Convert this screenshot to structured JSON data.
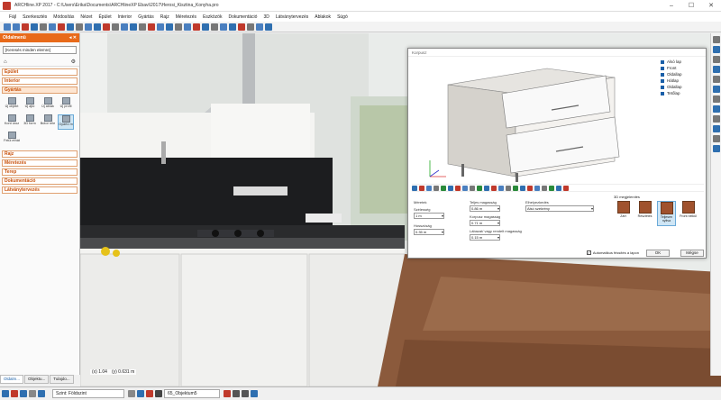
{
  "window": {
    "title": "ARCHline.XP 2017 - C:\\Users\\Erika\\Documents\\ARCHlineXP Ebavi\\2017\\Herosi_Kisztina_Konyha.pro",
    "minimize": "–",
    "maximize": "☐",
    "close": "✕"
  },
  "menu": [
    "Fájl",
    "Szerkesztés",
    "Módosítás",
    "Nézet",
    "Épület",
    "Interior",
    "Gyártás",
    "Rajz",
    "Méretezés",
    "Eszközök",
    "Dokumentáció",
    "3D",
    "Látványtervezés",
    "Ablakok",
    "Súgó"
  ],
  "sidebar": {
    "header": "Oldalmenü",
    "header_icons": "◂ ✕",
    "search_placeholder": "[Keresés minden elemre]",
    "categories": [
      {
        "label": "Épület"
      },
      {
        "label": "Interior"
      },
      {
        "label": "Gyártás"
      }
    ],
    "tools": [
      {
        "label": "Új objekt"
      },
      {
        "label": "Új ajtó"
      },
      {
        "label": "Új ablak"
      },
      {
        "label": "Új profil"
      },
      {
        "label": "Kont úroz"
      },
      {
        "label": "3D form"
      },
      {
        "label": "Bútor rele"
      },
      {
        "label": "Gyártó m"
      },
      {
        "label": "Felül ethát"
      }
    ],
    "categories_after": [
      {
        "label": "Rajz"
      },
      {
        "label": "Méretezés"
      },
      {
        "label": "Terep"
      },
      {
        "label": "Dokumentáció"
      },
      {
        "label": "Látványtervezés"
      }
    ],
    "tabs": [
      "Oldalm...",
      "Objektu...",
      "Tulajdo..."
    ]
  },
  "coords": {
    "x": "(x) 1.04",
    "y": "(y) 0.631 m"
  },
  "dialog": {
    "title": "Korpusz",
    "parts": [
      "Alsó lap",
      "Front",
      "Oldallap",
      "Hátlap",
      "Oldallap",
      "Tetőlap"
    ],
    "fields": {
      "szelesseg_label": "Szélesség",
      "szelesseg_value": "1 m",
      "hosszusag_label": "Hosszúság",
      "hosszusag_value": "0.35 m",
      "teljes_magassag_label": "Teljes magasság",
      "teljes_magassag_value": "0.86 m",
      "korpusz_magassag_label": "Korpusz magasság",
      "korpusz_magassag_value": "0.71 m",
      "labazat_label": "Lábazat/ vagy rendelt magasság",
      "labazat_value": "0.15 m",
      "elhelyezkedes_label": "Elhelyezkedés",
      "elhelyezkedes_value": "Alsó szekrény",
      "panel_label": "Méretek"
    },
    "variants": {
      "label": "3D megjelenítés",
      "items": [
        "Zárt",
        "Részletes",
        "Teljesen nyitva",
        "Front nélkül"
      ]
    },
    "auto_update_label": "Automatikus frissítés a lapon",
    "ok_label": "OK",
    "cancel_label": "Mégse"
  },
  "statusbar": {
    "level": "Szint: Földszint",
    "object": "65_Objektum5"
  }
}
